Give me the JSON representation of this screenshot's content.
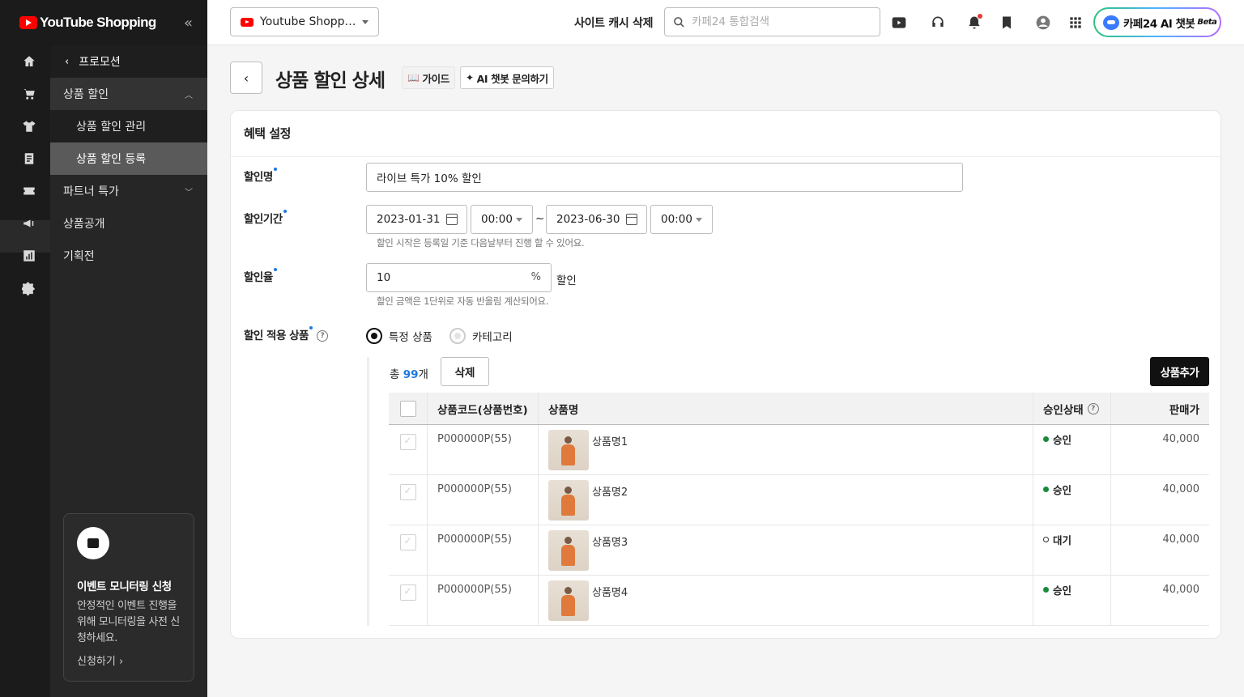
{
  "brand": {
    "name": "YouTube Shopping"
  },
  "topbar": {
    "shop_select": "Youtube Shopping",
    "cache_delete": "사이트 캐시 삭제",
    "search_placeholder": "카페24 통합검색",
    "ai_button": "카페24 AI 챗봇",
    "ai_beta": "Beta"
  },
  "sidebar": {
    "header": "프로모션",
    "items": [
      {
        "label": "상품 할인"
      },
      {
        "label": "상품 할인 관리"
      },
      {
        "label": "상품 할인 등록"
      },
      {
        "label": "파트너 특가"
      },
      {
        "label": "상품공개"
      },
      {
        "label": "기획전"
      }
    ],
    "promo": {
      "title": "이벤트 모니터링 신청",
      "desc": "안정적인 이벤트 진행을 위해 모니터링을 사전 신청하세요.",
      "link": "신청하기 ›"
    }
  },
  "page": {
    "title": "상품 할인 상세",
    "guide_label": "가이드",
    "ask_label": "AI 챗봇 문의하기"
  },
  "form": {
    "section_title": "혜택 설정",
    "name_label": "할인명",
    "name_value": "라이브 특가 10% 할인",
    "period_label": "할인기간",
    "start_date": "2023-01-31",
    "start_time": "00:00",
    "tilde": "~",
    "end_date": "2023-06-30",
    "end_time": "00:00",
    "period_help": "할인 시작은 등록일 기준 다음날부터 진행 할 수 있어요.",
    "rate_label": "할인율",
    "rate_value": "10",
    "rate_unit": "%",
    "rate_suffix": "할인",
    "rate_help": "할인 금액은 1단위로 자동 반올림 계산되어요.",
    "target_label": "할인 적용 상품",
    "radio_specific": "특정 상품",
    "radio_category": "카테고리",
    "count_prefix": "총 ",
    "count_value": "99",
    "count_suffix": "개",
    "delete_btn": "삭제",
    "add_btn": "상품추가"
  },
  "table": {
    "headers": {
      "code": "상품코드(상품번호)",
      "name": "상품명",
      "status": "승인상태",
      "price": "판매가"
    },
    "rows": [
      {
        "code": "P000000P(55)",
        "name": "상품명1",
        "status": "승인",
        "status_type": "ok",
        "price": "40,000"
      },
      {
        "code": "P000000P(55)",
        "name": "상품명2",
        "status": "승인",
        "status_type": "ok",
        "price": "40,000"
      },
      {
        "code": "P000000P(55)",
        "name": "상품명3",
        "status": "대기",
        "status_type": "wait",
        "price": "40,000"
      },
      {
        "code": "P000000P(55)",
        "name": "상품명4",
        "status": "승인",
        "status_type": "ok",
        "price": "40,000"
      }
    ]
  }
}
